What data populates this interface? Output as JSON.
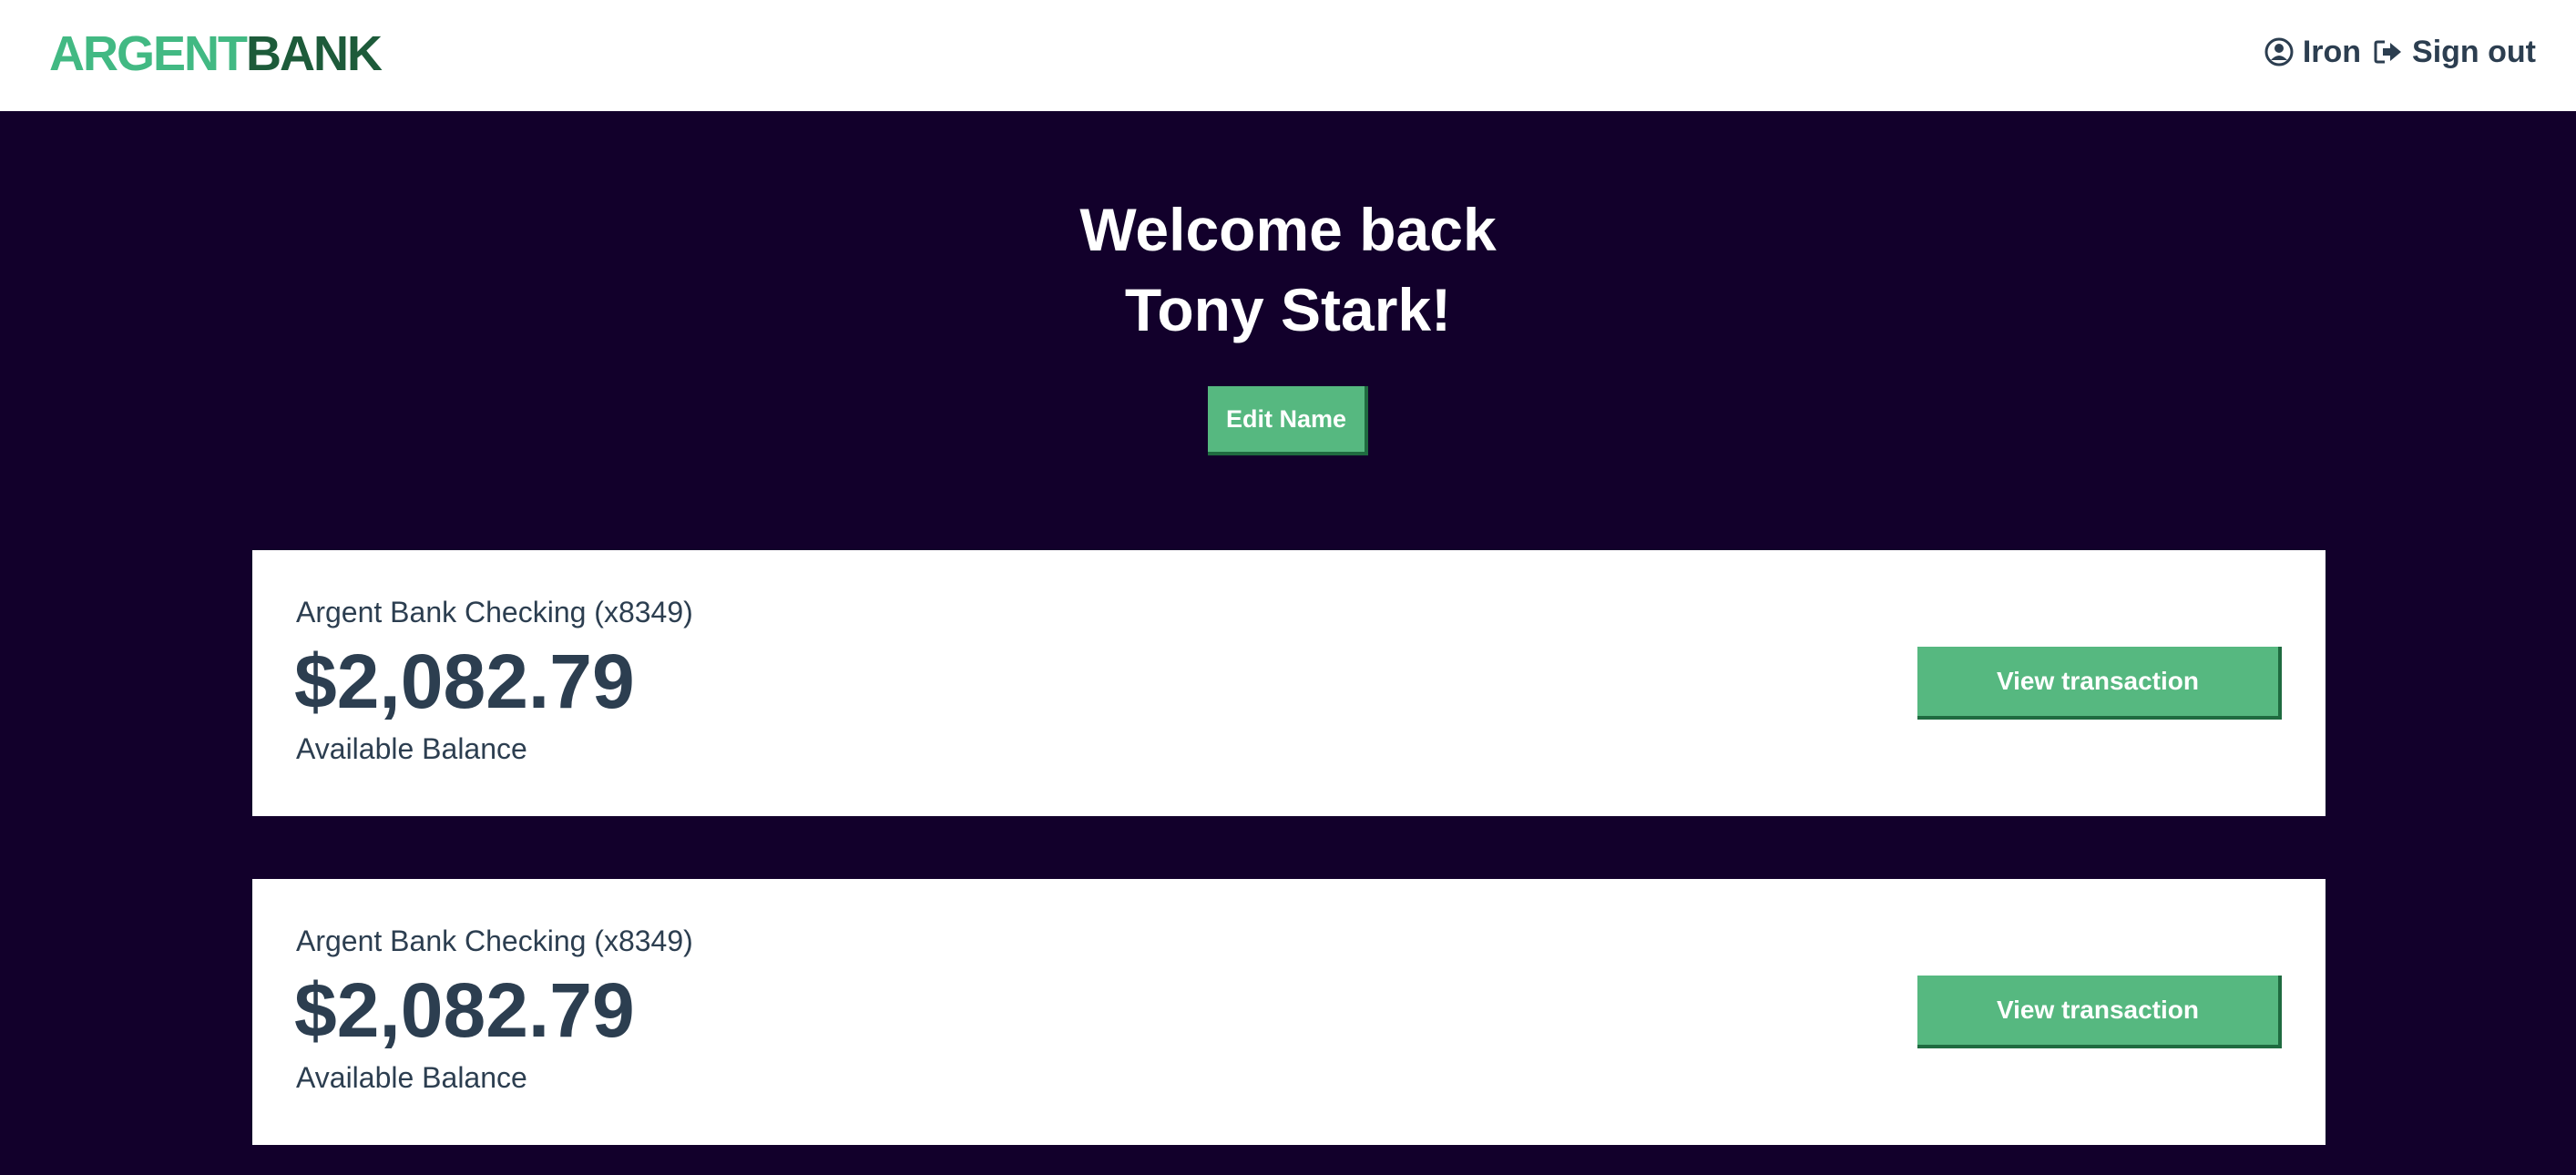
{
  "brand": {
    "part1": "ARGENT",
    "part2": "BANK",
    "colors": {
      "part1": "#42b983",
      "part2": "#1d5b3a"
    }
  },
  "nav": {
    "user_name": "Iron",
    "user_icon": "user-circle-icon",
    "signout_label": "Sign out",
    "signout_icon": "sign-out-icon"
  },
  "hero": {
    "title_line1": "Welcome back",
    "title_line2": "Tony Stark!",
    "edit_button": "Edit Name"
  },
  "accounts": [
    {
      "title": "Argent Bank Checking (x8349)",
      "amount": "$2,082.79",
      "description": "Available Balance",
      "button": "View transaction"
    },
    {
      "title": "Argent Bank Checking (x8349)",
      "amount": "$2,082.79",
      "description": "Available Balance",
      "button": "View transaction"
    }
  ],
  "theme": {
    "background": "#12002b",
    "accent": "#56b880",
    "text": "#2c3e50"
  }
}
